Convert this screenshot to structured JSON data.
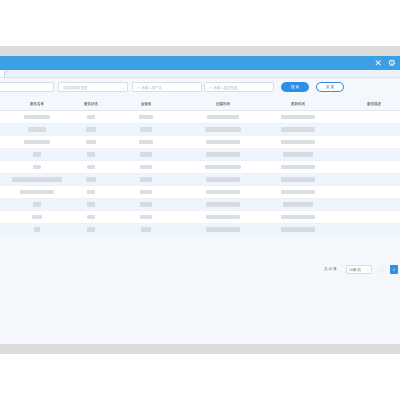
{
  "window": {
    "close_icon": "close-icon",
    "settings_icon": "gear-icon",
    "tab_indicator": "›"
  },
  "filters": {
    "field1_placeholder": "",
    "field2_placeholder": "请选择服务类型",
    "field3_placeholder": "请输入用户名",
    "field4_placeholder": "请输入描述信息",
    "search_label": "搜 索",
    "reset_label": "重 置"
  },
  "table": {
    "columns": [
      "服务名称",
      "服务状态",
      "运营商",
      "创建时间",
      "更新时间",
      "服务描述"
    ],
    "row_count": 10
  },
  "pagination": {
    "total_text": "共 20 条",
    "page_size": "10条/页",
    "prev": "‹",
    "current_page": "1"
  },
  "colors": {
    "titlebar": "#3c9fe6",
    "primary": "#2f8fe8",
    "row_alt": "#eef5fd"
  }
}
